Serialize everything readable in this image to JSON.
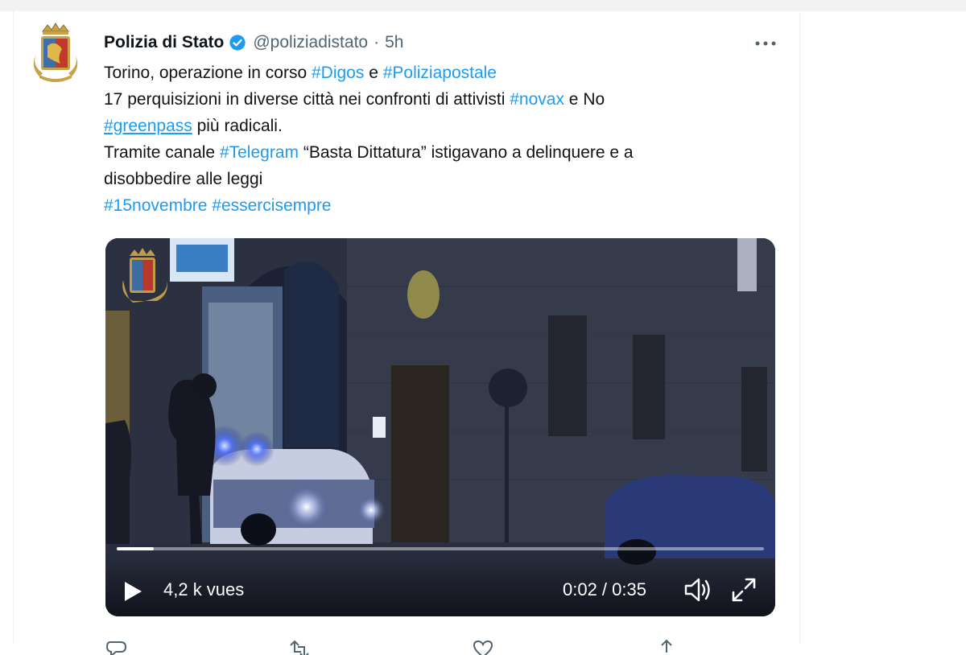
{
  "tweet": {
    "author": {
      "name": "Polizia di Stato",
      "handle": "@poliziadistato",
      "separator": "·",
      "time": "5h"
    },
    "text": {
      "l1_a": "Torino, operazione in corso ",
      "l1_tag1": "#Digos",
      "l1_b": " e ",
      "l1_tag2": "#Poliziapostale",
      "l2_a": "17 perquisizioni in diverse città nei confronti di attivisti ",
      "l2_tag": "#novax",
      "l2_b": " e No",
      "l3_tag": "#greenpass",
      "l3_b": " più radicali.",
      "l4_a": "Tramite canale ",
      "l4_tag": "#Telegram",
      "l4_b": " “Basta Dittatura” istigavano a delinquere e a",
      "l5": "disobbedire alle leggi",
      "l6_tag1": "#15novembre",
      "l6_tag2": "#essercisempre"
    },
    "video": {
      "views": "4,2 k vues",
      "time": "0:02 / 0:35",
      "progress": 0.057
    }
  },
  "icons": [
    "polizia-logo-icon",
    "verified-badge-icon",
    "more-options-icon",
    "play-icon",
    "volume-icon",
    "fullscreen-icon",
    "reply-icon",
    "retweet-icon",
    "like-icon",
    "share-icon"
  ],
  "colors": {
    "link": "#1d9bf0",
    "verified": "#1d9bf0",
    "secondary": "#536471",
    "text": "#0f1419"
  }
}
